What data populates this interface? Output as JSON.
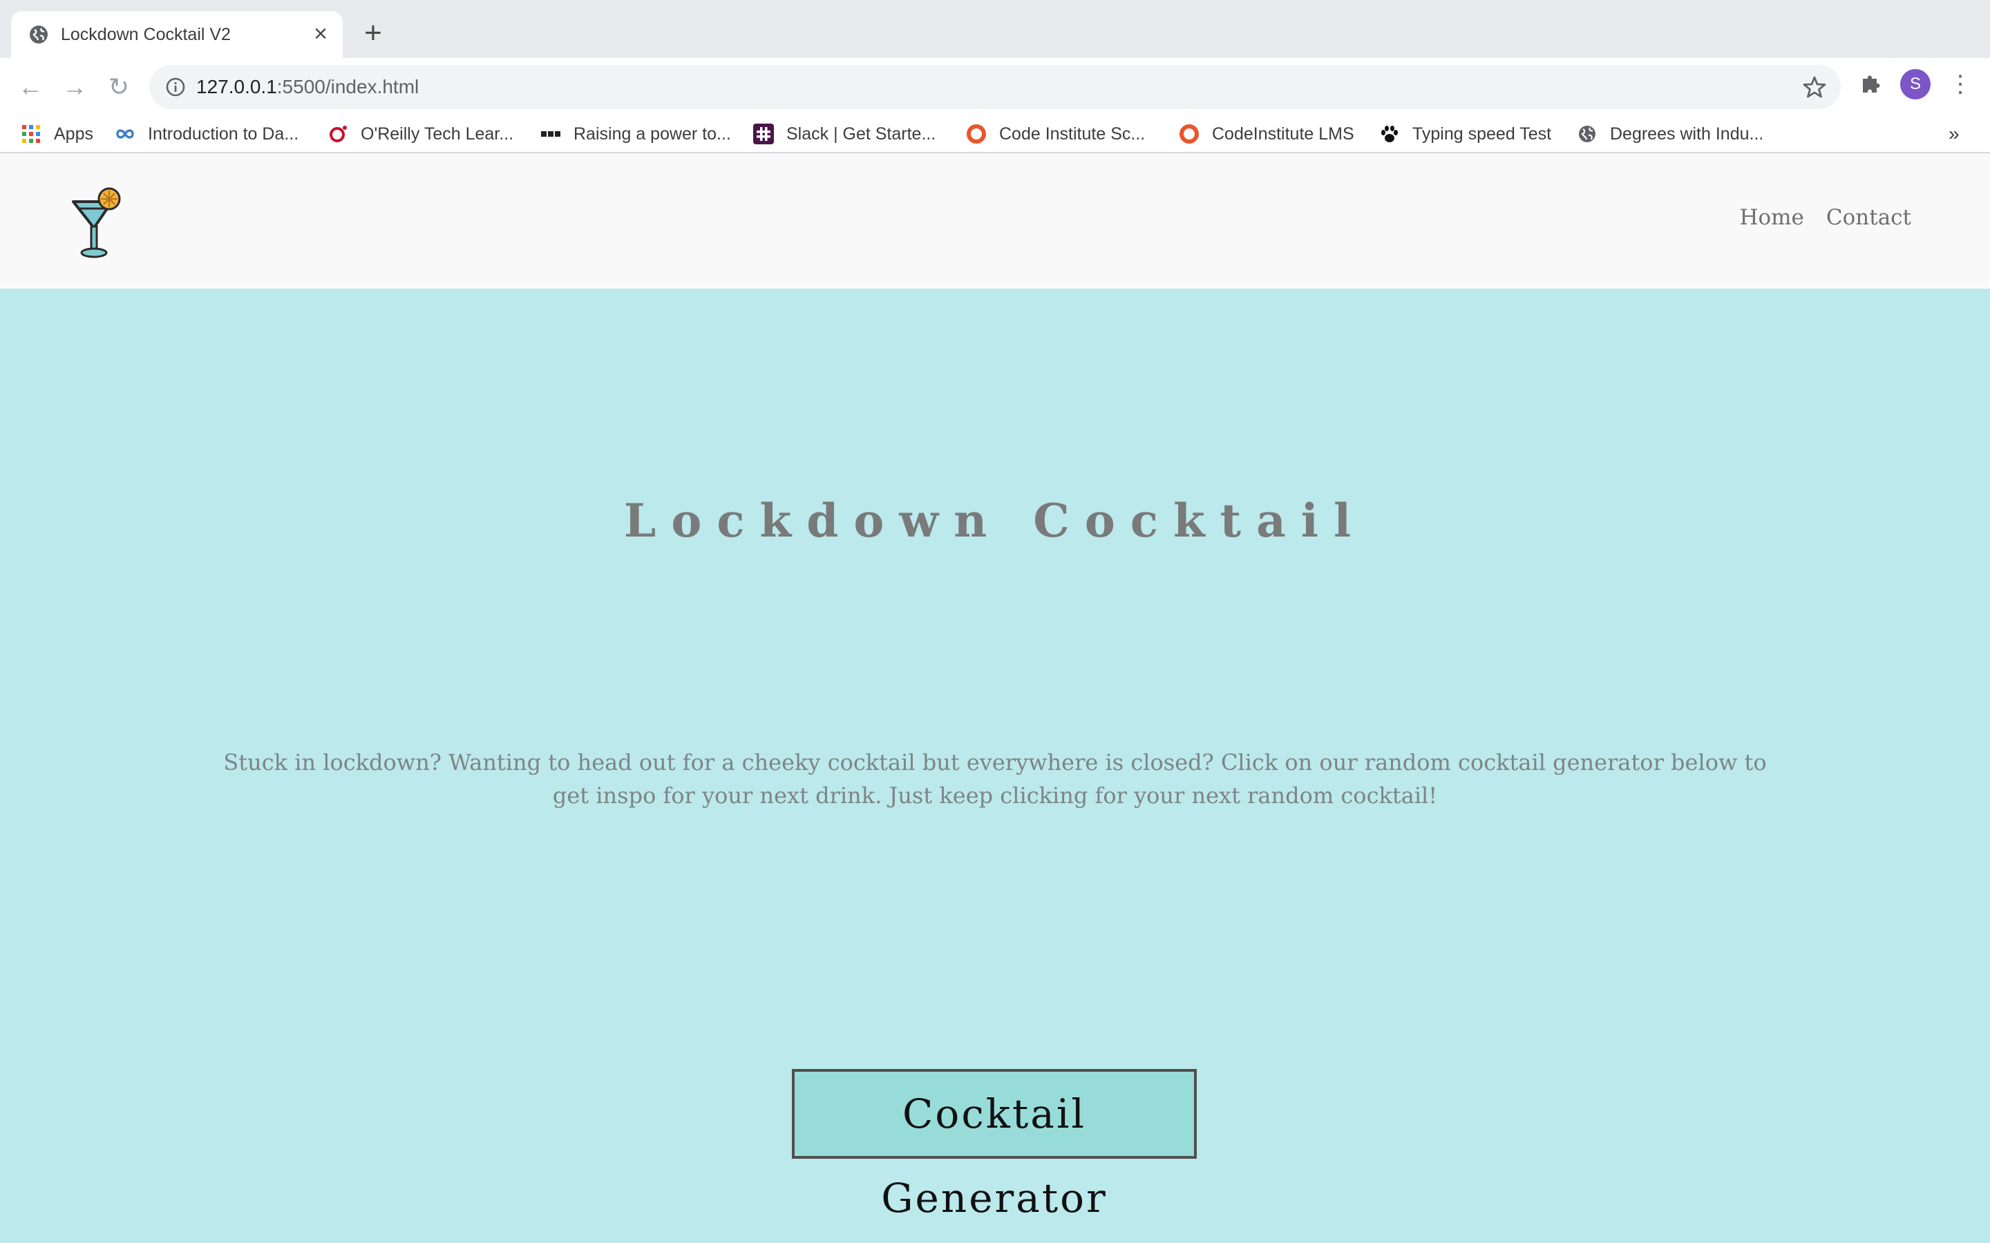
{
  "browser": {
    "tab": {
      "title": "Lockdown Cocktail V2",
      "close": "×"
    },
    "new_tab": "+",
    "nav": {
      "back": "←",
      "forward": "→",
      "reload": "↻"
    },
    "url": {
      "host": "127.0.0.1",
      "rest": ":5500/index.html"
    },
    "profile_initial": "S",
    "menu": "⋮",
    "bookmarks": [
      {
        "label": "Apps",
        "icon": "apps-grid-icon"
      },
      {
        "label": "Introduction to Da...",
        "icon": "infinity-icon"
      },
      {
        "label": "O'Reilly Tech Lear...",
        "icon": "oreilly-icon"
      },
      {
        "label": "Raising a power to...",
        "icon": "bbc-icon"
      },
      {
        "label": "Slack | Get Starte...",
        "icon": "slack-icon"
      },
      {
        "label": "Code Institute Sc...",
        "icon": "code-institute-icon"
      },
      {
        "label": "CodeInstitute LMS",
        "icon": "code-institute-icon"
      },
      {
        "label": "Typing speed Test",
        "icon": "paw-icon"
      },
      {
        "label": "Degrees with Indu...",
        "icon": "globe-icon"
      }
    ],
    "bookmarks_more": "»"
  },
  "site": {
    "nav": {
      "home": "Home",
      "contact": "Contact"
    },
    "title": "Lockdown Cocktail",
    "intro": "Stuck in lockdown? Wanting to head out for a cheeky cocktail but everywhere is closed? Click on our random cocktail generator below to get inspo for your next drink. Just keep clicking for your next random cocktail!",
    "button": "Cocktail Generator"
  },
  "colors": {
    "page_background": "#bbe9ec",
    "nav_background": "#f9f9f9",
    "button_background": "#98dcda",
    "title_text": "#7a7a7a"
  }
}
